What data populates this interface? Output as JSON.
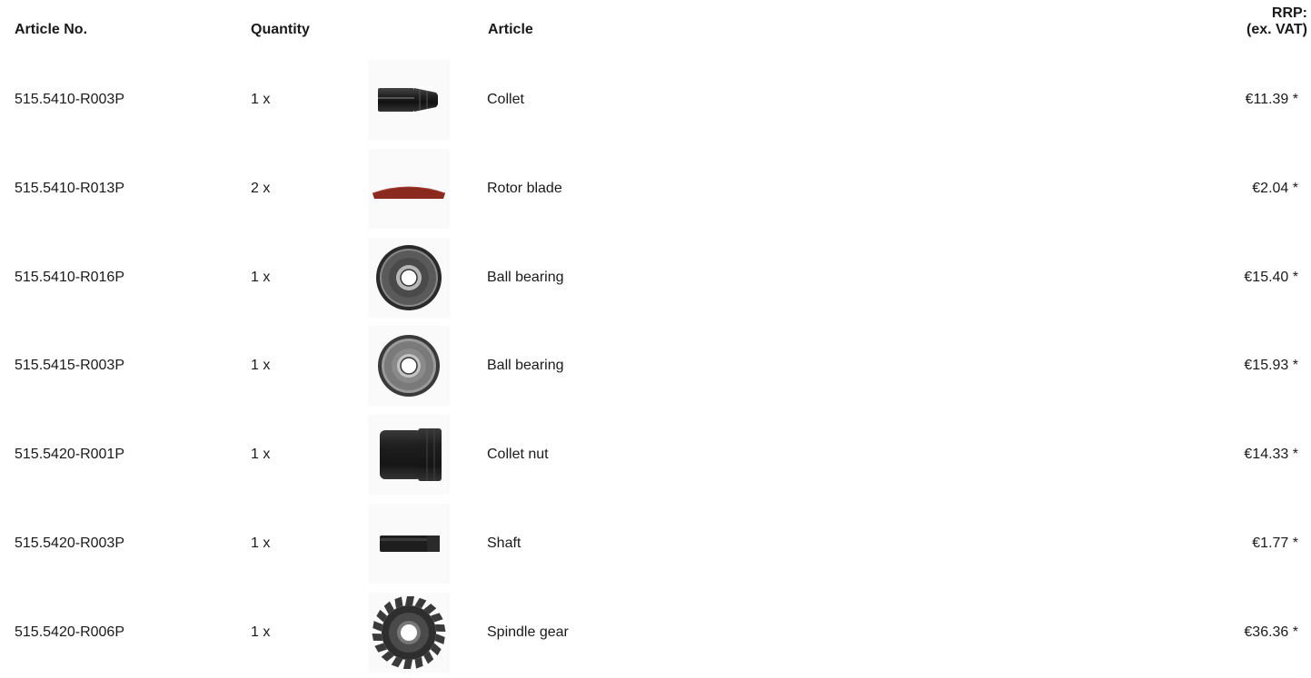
{
  "table": {
    "headers": {
      "article_no": "Article No.",
      "quantity": "Quantity",
      "article": "Article",
      "rrp_line1": "RRP:",
      "rrp_line2": "(ex. VAT)"
    },
    "rows": [
      {
        "article_no": "515.5410-R003P",
        "quantity": "1 x",
        "image_icon": "collet-icon",
        "article": "Collet",
        "price": "€11.39 *"
      },
      {
        "article_no": "515.5410-R013P",
        "quantity": "2 x",
        "image_icon": "rotor-blade-icon",
        "article": "Rotor blade",
        "price": "€2.04 *"
      },
      {
        "article_no": "515.5410-R016P",
        "quantity": "1 x",
        "image_icon": "ball-bearing-icon",
        "article": "Ball bearing",
        "price": "€15.40 *"
      },
      {
        "article_no": "515.5415-R003P",
        "quantity": "1 x",
        "image_icon": "ball-bearing-icon",
        "article": "Ball bearing",
        "price": "€15.93 *"
      },
      {
        "article_no": "515.5420-R001P",
        "quantity": "1 x",
        "image_icon": "collet-nut-icon",
        "article": "Collet nut",
        "price": "€14.33 *"
      },
      {
        "article_no": "515.5420-R003P",
        "quantity": "1 x",
        "image_icon": "shaft-icon",
        "article": "Shaft",
        "price": "€1.77 *"
      },
      {
        "article_no": "515.5420-R006P",
        "quantity": "1 x",
        "image_icon": "spindle-gear-icon",
        "article": "Spindle gear",
        "price": "€36.36 *"
      }
    ]
  }
}
